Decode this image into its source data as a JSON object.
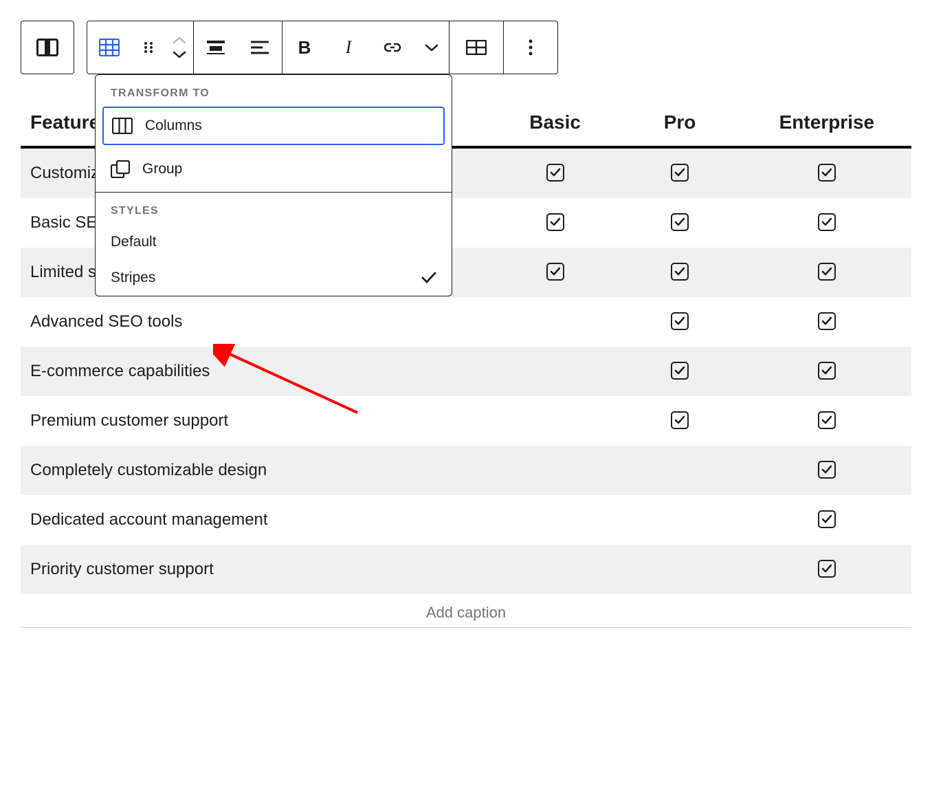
{
  "popover": {
    "transform_header": "Transform to",
    "transform_items": [
      {
        "label": "Columns",
        "selected": true
      },
      {
        "label": "Group",
        "selected": false
      }
    ],
    "styles_header": "Styles",
    "style_items": [
      {
        "label": "Default",
        "checked": false
      },
      {
        "label": "Stripes",
        "checked": true
      }
    ]
  },
  "table": {
    "headers": [
      "Features",
      "Basic",
      "Pro",
      "Enterprise"
    ],
    "rows": [
      {
        "feature": "Customizable homepage",
        "basic": true,
        "pro": true,
        "enterprise": true
      },
      {
        "feature": "Basic SEO tools",
        "basic": true,
        "pro": true,
        "enterprise": true
      },
      {
        "feature": "Limited support",
        "basic": true,
        "pro": true,
        "enterprise": true
      },
      {
        "feature": "Advanced SEO tools",
        "basic": false,
        "pro": true,
        "enterprise": true
      },
      {
        "feature": "E-commerce capabilities",
        "basic": false,
        "pro": true,
        "enterprise": true
      },
      {
        "feature": "Premium customer support",
        "basic": false,
        "pro": true,
        "enterprise": true
      },
      {
        "feature": "Completely customizable design",
        "basic": false,
        "pro": false,
        "enterprise": true
      },
      {
        "feature": "Dedicated account management",
        "basic": false,
        "pro": false,
        "enterprise": true
      },
      {
        "feature": "Priority customer support",
        "basic": false,
        "pro": false,
        "enterprise": true
      }
    ],
    "caption_placeholder": "Add caption"
  }
}
